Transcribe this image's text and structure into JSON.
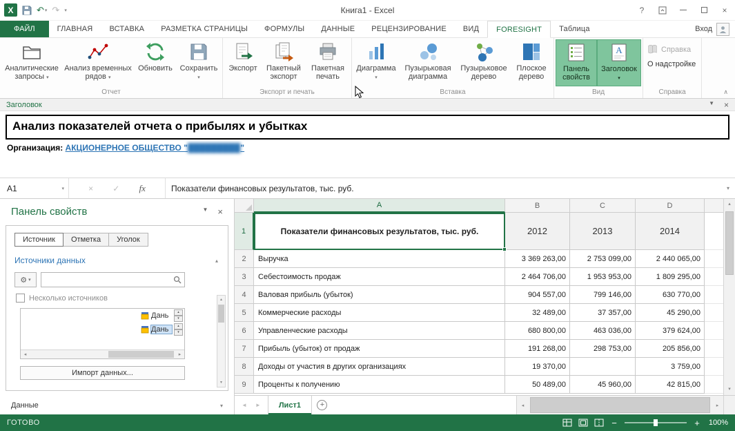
{
  "icons": {
    "excel_logo": "X",
    "dropdown": "▾",
    "up": "▴",
    "down": "▾",
    "left": "◂",
    "right": "▸",
    "left_tri": "◄",
    "right_tri": "►",
    "down_tri": "▼",
    "close": "×",
    "help": "?",
    "undo": "↶",
    "redo": "↷",
    "check": "✓",
    "fx": "fx",
    "collapse": "∧",
    "gear": "⚙",
    "plus": "+",
    "minus": "−"
  },
  "titlebar": {
    "title": "Книга1 - Excel"
  },
  "tabrow": {
    "file": "ФАЙЛ",
    "tabs": [
      "ГЛАВНАЯ",
      "ВСТАВКА",
      "РАЗМЕТКА СТРАНИЦЫ",
      "ФОРМУЛЫ",
      "ДАННЫЕ",
      "РЕЦЕНЗИРОВАНИЕ",
      "ВИД",
      "FORESIGHT",
      "Таблица"
    ],
    "sign_in": "Вход"
  },
  "ribbon": {
    "groups": [
      {
        "label": "Отчет"
      },
      {
        "label": "Экспорт и печать"
      },
      {
        "label": "Вставка"
      },
      {
        "label": "Вид"
      },
      {
        "label": "Справка"
      }
    ],
    "buttons": {
      "analytical_queries": "Аналитические запросы",
      "time_series": "Анализ временных рядов",
      "refresh": "Обновить",
      "save": "Сохранить",
      "export": "Экспорт",
      "batch_export": "Пакетный экспорт",
      "batch_print": "Пакетная печать",
      "chart": "Диаграмма",
      "bubble_chart": "Пузырьковая диаграмма",
      "bubble_tree": "Пузырьковое дерево",
      "flat_tree": "Плоское дерево",
      "props_pane": "Панель свойств",
      "header": "Заголовок",
      "help": "Справка",
      "about": "О надстройке"
    }
  },
  "header_panel": {
    "title": "Заголовок",
    "report_title": "Анализ показателей отчета о прибылях и убытках",
    "org_label": "Организация:",
    "org_link_prefix": "АКЦИОНЕРНОЕ ОБЩЕСТВО \"",
    "org_link_redacted": "█████████",
    "org_link_suffix": "\""
  },
  "formula_bar": {
    "name_box": "A1",
    "formula": "Показатели финансовых результатов, тыс. руб."
  },
  "properties_panel": {
    "title": "Панель свойств",
    "tabs": [
      "Источник",
      "Отметка",
      "Уголок"
    ],
    "sources_header": "Источники данных",
    "multiple_sources": "Несколько источников",
    "list_items": [
      {
        "label": "Дань"
      },
      {
        "label": "Дань"
      }
    ],
    "import_button": "Импорт данных...",
    "data_header": "Данные"
  },
  "spreadsheet": {
    "columns": [
      "A",
      "B",
      "C",
      "D"
    ],
    "row1": {
      "n": "1",
      "a": "Показатели финансовых результатов, тыс. руб.",
      "years": [
        "2012",
        "2013",
        "2014"
      ]
    },
    "rows": [
      {
        "n": "2",
        "label": "Выручка",
        "values": [
          "3 369 263,00",
          "2 753 099,00",
          "2 440 065,00"
        ]
      },
      {
        "n": "3",
        "label": "Себестоимость продаж",
        "values": [
          "2 464 706,00",
          "1 953 953,00",
          "1 809 295,00"
        ]
      },
      {
        "n": "4",
        "label": "Валовая прибыль (убыток)",
        "values": [
          "904 557,00",
          "799 146,00",
          "630 770,00"
        ]
      },
      {
        "n": "5",
        "label": "Коммерческие расходы",
        "values": [
          "32 489,00",
          "37 357,00",
          "45 290,00"
        ]
      },
      {
        "n": "6",
        "label": "Управленческие расходы",
        "values": [
          "680 800,00",
          "463 036,00",
          "379 624,00"
        ]
      },
      {
        "n": "7",
        "label": "Прибыль (убыток) от продаж",
        "values": [
          "191 268,00",
          "298 753,00",
          "205 856,00"
        ]
      },
      {
        "n": "8",
        "label": "Доходы от участия в других организациях",
        "values": [
          "19 370,00",
          "",
          "3 759,00"
        ]
      },
      {
        "n": "9",
        "label": "Проценты к получению",
        "values": [
          "50 489,00",
          "45 960,00",
          "42 815,00"
        ]
      }
    ]
  },
  "sheet_bar": {
    "tab": "Лист1"
  },
  "status_bar": {
    "ready": "ГОТОВО",
    "zoom": "100%"
  }
}
